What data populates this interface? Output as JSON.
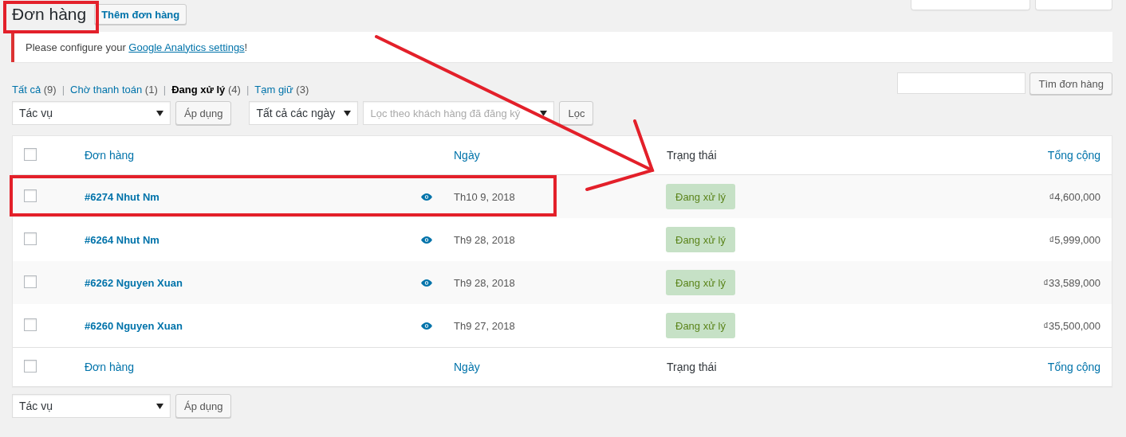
{
  "page": {
    "title": "Đơn hàng",
    "add_button": "Thêm đơn hàng",
    "top_buttons": [
      {
        "kind": "screen-options"
      },
      {
        "kind": "help"
      }
    ]
  },
  "notice": {
    "before": "Please configure your ",
    "link": "Google Analytics settings",
    "after": "!"
  },
  "views": [
    {
      "label": "Tất cả",
      "count": "(9)",
      "selected": false
    },
    {
      "separator": "|",
      "label": "Chờ thanh toán",
      "count": "(1)",
      "selected": false
    },
    {
      "separator": "|",
      "label": "Đang xử lý",
      "count": "(4)",
      "selected": true
    },
    {
      "separator": "|",
      "label": "Tạm giữ",
      "count": "(3)",
      "selected": false
    }
  ],
  "search": {
    "button": "Tìm đơn hàng"
  },
  "filters": {
    "bulk_action": "Tác vụ",
    "apply": "Áp dụng",
    "date": "Tất cả các ngày",
    "customer_placeholder": "Lọc theo khách hàng đã đăng ký",
    "filter": "Lọc"
  },
  "table": {
    "columns": [
      {
        "label": "Đơn hàng",
        "sortable": true
      },
      {
        "label": "Ngày",
        "sortable": true
      },
      {
        "label": "Trạng thái",
        "sortable": false
      },
      {
        "label": "Tổng cộng",
        "sortable": true
      }
    ],
    "header_checked": false,
    "rows": [
      {
        "checked": false,
        "order": "#6274 Nhut Nm",
        "date": "Th10 9, 2018",
        "status": "Đang xử lý",
        "total": "₫4,600,000"
      },
      {
        "checked": false,
        "order": "#6264 Nhut Nm",
        "date": "Th9 28, 2018",
        "status": "Đang xử lý",
        "total": "₫5,999,000"
      },
      {
        "checked": false,
        "order": "#6262 Nguyen Xuan",
        "date": "Th9 28, 2018",
        "status": "Đang xử lý",
        "total": "₫33,589,000"
      },
      {
        "checked": false,
        "order": "#6260 Nguyen Xuan",
        "date": "Th9 27, 2018",
        "status": "Đang xử lý",
        "total": "₫35,500,000"
      }
    ],
    "footer_columns": [
      {
        "label": "Đơn hàng",
        "sortable": true
      },
      {
        "label": "Ngày",
        "sortable": true
      },
      {
        "label": "Trạng thái",
        "sortable": false
      },
      {
        "label": "Tổng cộng",
        "sortable": true
      }
    ],
    "footer_checked": false
  },
  "bottom_filters": {
    "bulk_action": "Tác vụ",
    "apply": "Áp dụng"
  }
}
